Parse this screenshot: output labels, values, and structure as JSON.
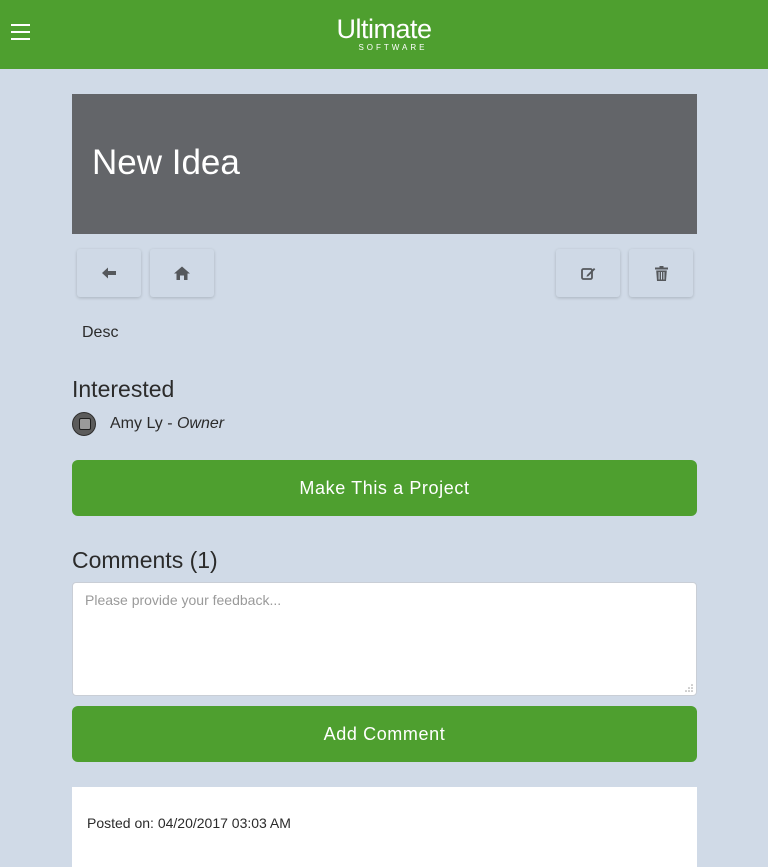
{
  "header": {
    "menu_icon": "hamburger-icon",
    "logo_main": "Ultimate",
    "logo_sub": "SOFTWARE",
    "brand_color": "#4e9f2f"
  },
  "idea": {
    "title": "New Idea",
    "description": "Desc"
  },
  "toolbar": {
    "back_icon": "arrow-left-icon",
    "home_icon": "home-icon",
    "edit_icon": "edit-icon",
    "delete_icon": "trash-icon"
  },
  "interested": {
    "heading": "Interested",
    "members": [
      {
        "name": "Amy Ly",
        "separator": " - ",
        "role": "Owner"
      }
    ]
  },
  "actions": {
    "make_project_label": "Make This a Project",
    "add_comment_label": "Add Comment"
  },
  "comments": {
    "heading": "Comments (1)",
    "input_placeholder": "Please provide your feedback...",
    "input_value": "",
    "items": [
      {
        "posted_on": "Posted on: 04/20/2017 03:03 AM"
      }
    ]
  },
  "colors": {
    "page_background": "#d0dae7",
    "hero_background": "#636569",
    "button_green": "#4e9f2f"
  }
}
